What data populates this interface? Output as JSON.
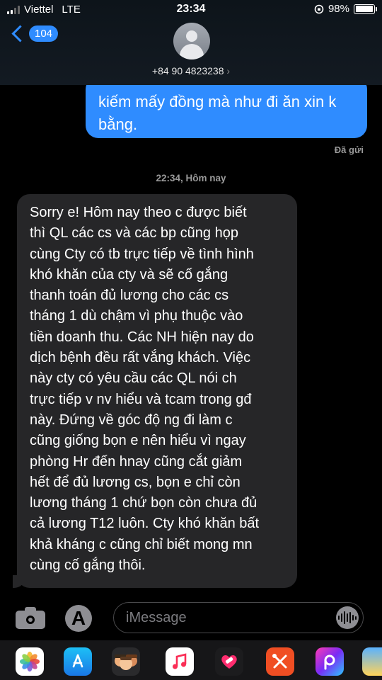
{
  "status_bar": {
    "carrier": "Viettel",
    "network": "LTE",
    "time": "23:34",
    "battery_percent": "98%",
    "battery_level": 0.98,
    "signal_bars": 2
  },
  "header": {
    "unread_count": "104",
    "contact_number": "+84 90 4823238",
    "contact_chevron": "›"
  },
  "conversation": {
    "sent_message": {
      "lines": [
        "kiếm mấy đồng mà như đi ăn xin k",
        "bằng."
      ]
    },
    "delivered_label": "Đã gửi",
    "timestamp": "22:34, Hôm nay",
    "received_message": {
      "lines": [
        "Sorry e! Hôm nay theo c được biết",
        "thì QL các cs và các bp cũng họp",
        "cùng Cty có tb trực tiếp về tình hình",
        "khó khăn của cty và sẽ cố gắng",
        "thanh toán đủ lương cho các cs",
        "tháng 1 dù chậm vì phụ thuộc vào",
        "tiền doanh thu. Các NH hiện nay do",
        "dịch bệnh đều rất vắng khách. Việc",
        "này cty có yêu cầu các QL nói ch",
        "trực tiếp v nv hiểu và tcam trong gđ",
        "này. Đứng về góc độ ng đi làm c",
        "cũng giống bọn e nên hiểu vì ngay",
        "phòng Hr đến hnay cũng cắt giảm",
        "hết để đủ lương cs, bọn e chỉ còn",
        "lương tháng 1 chứ bọn còn chưa đủ",
        "cả lương T12 luôn. Cty khó khăn bất",
        "khả kháng c cũng chỉ biết mong mn",
        "cùng cố gắng thôi."
      ]
    }
  },
  "composer": {
    "placeholder": "iMessage",
    "appstore_glyph": "A"
  },
  "app_drawer": {
    "apps": [
      "photos-app",
      "app-store-app",
      "memoji-app",
      "music-app",
      "digital-touch-app",
      "tools-app",
      "picsart-app",
      "more-app"
    ]
  },
  "colors": {
    "accent_blue": "#2f8cff",
    "received_bubble": "#262628",
    "background": "#000000"
  }
}
